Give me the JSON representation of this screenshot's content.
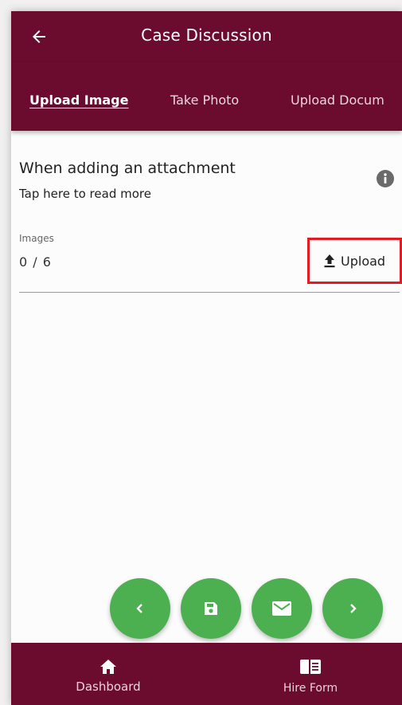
{
  "header": {
    "title": "Case Discussion",
    "back_icon": "arrow-left-icon"
  },
  "tabs": [
    {
      "label": "Upload Image",
      "active": true
    },
    {
      "label": "Take Photo",
      "active": false
    },
    {
      "label": "Upload Docum",
      "active": false
    }
  ],
  "info": {
    "heading": "When adding an attachment",
    "subtext": "Tap here to read more",
    "icon": "info-icon"
  },
  "images": {
    "label": "Images",
    "count": "0 / 6",
    "upload_label": "Upload",
    "upload_icon": "upload-icon"
  },
  "actions": [
    {
      "name": "previous",
      "icon": "chevron-left-icon"
    },
    {
      "name": "save",
      "icon": "save-icon"
    },
    {
      "name": "email",
      "icon": "mail-icon"
    },
    {
      "name": "next",
      "icon": "chevron-right-icon"
    }
  ],
  "bottom_nav": [
    {
      "label": "Dashboard",
      "icon": "home-icon"
    },
    {
      "label": "Hire Form",
      "icon": "form-icon"
    }
  ],
  "colors": {
    "primary": "#6b0b2e",
    "fab": "#4caf50",
    "highlight": "#e21b25"
  }
}
